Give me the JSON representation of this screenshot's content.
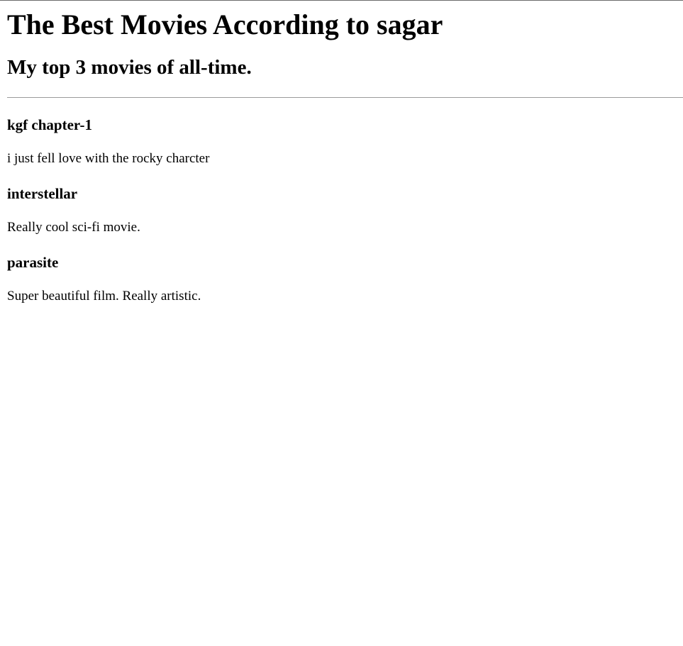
{
  "page": {
    "title": "The Best Movies According to sagar",
    "subtitle": "My top 3 movies of all-time."
  },
  "movies": [
    {
      "name": "kgf chapter-1",
      "description": "i just fell love with the rocky charcter"
    },
    {
      "name": "interstellar",
      "description": "Really cool sci-fi movie."
    },
    {
      "name": "parasite",
      "description": "Super beautiful film. Really artistic."
    }
  ]
}
